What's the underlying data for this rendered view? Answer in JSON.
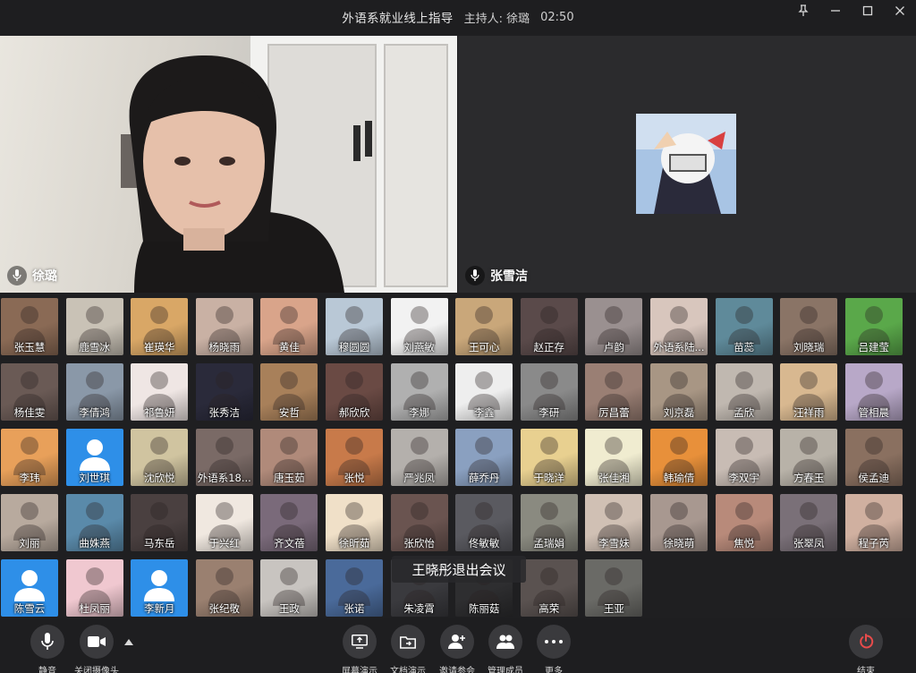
{
  "window": {
    "title": "外语系就业线上指导",
    "host": "主持人: 徐璐",
    "time": "02:50"
  },
  "main_videos": {
    "left_name": "徐璐",
    "right_name": "张雪洁"
  },
  "participants": [
    {
      "name": "张玉慧",
      "color": "#8a6a55"
    },
    {
      "name": "鹿雪冰",
      "color": "#c9c2b6"
    },
    {
      "name": "崔瑛华",
      "color": "#d9a766"
    },
    {
      "name": "杨晓雨",
      "color": "#c9b1a4"
    },
    {
      "name": "黄佳",
      "color": "#d9a48a"
    },
    {
      "name": "穆圆圆",
      "color": "#b9c8d6"
    },
    {
      "name": "刘燕敏",
      "color": "#f2f2f2"
    },
    {
      "name": "王可心",
      "color": "#c9a77a"
    },
    {
      "name": "赵正存",
      "color": "#5a4a4a"
    },
    {
      "name": "卢韵",
      "color": "#9a9090"
    },
    {
      "name": "外语系陆...",
      "color": "#d8c6bd"
    },
    {
      "name": "苗蕊",
      "color": "#5f8a9a"
    },
    {
      "name": "刘晓瑞",
      "color": "#8a7466"
    },
    {
      "name": "吕建莹",
      "color": "#5aa84a"
    },
    {
      "name": "杨佳雯",
      "color": "#6a5a55"
    },
    {
      "name": "李倩鸿",
      "color": "#8a98a8"
    },
    {
      "name": "祁鲁妍",
      "color": "#efe6e4"
    },
    {
      "name": "张秀洁",
      "color": "#2a2a3a"
    },
    {
      "name": "安哲",
      "color": "#a8805a"
    },
    {
      "name": "郝欣欣",
      "color": "#6a4a44"
    },
    {
      "name": "李娜",
      "color": "#b0b0b0"
    },
    {
      "name": "李鑫",
      "color": "#eeeeee"
    },
    {
      "name": "李研",
      "color": "#8a8a8a"
    },
    {
      "name": "厉昌蕾",
      "color": "#9a7f74"
    },
    {
      "name": "刘京磊",
      "color": "#a89684"
    },
    {
      "name": "孟欣",
      "color": "#c0b8b0"
    },
    {
      "name": "汪祥雨",
      "color": "#d8b890"
    },
    {
      "name": "管相晨",
      "color": "#b8a8c8"
    },
    {
      "name": "李玮",
      "color": "#e8a05a"
    },
    {
      "name": "刘世琪",
      "color": "#2e8fe8",
      "avatar": true
    },
    {
      "name": "沈欣悦",
      "color": "#d0c4a0"
    },
    {
      "name": "外语系18...",
      "color": "#7a6a66"
    },
    {
      "name": "唐玉茹",
      "color": "#b08a7a"
    },
    {
      "name": "张悦",
      "color": "#c87a4a"
    },
    {
      "name": "严兆凤",
      "color": "#b4b0ac"
    },
    {
      "name": "薛乔丹",
      "color": "#8aa0c0"
    },
    {
      "name": "于晓洋",
      "color": "#e8d090"
    },
    {
      "name": "张佳湘",
      "color": "#f0ecd0"
    },
    {
      "name": "韩瑜倩",
      "color": "#e8903a"
    },
    {
      "name": "李双宇",
      "color": "#c8bcb4"
    },
    {
      "name": "方春玉",
      "color": "#b8b2a8"
    },
    {
      "name": "侯孟迪",
      "color": "#8a7060"
    },
    {
      "name": "刘丽",
      "color": "#b8aa9e"
    },
    {
      "name": "曲姝燕",
      "color": "#5a8aaa"
    },
    {
      "name": "马东岳",
      "color": "#4a4040"
    },
    {
      "name": "于兴红",
      "color": "#f0e8e0"
    },
    {
      "name": "齐文蓓",
      "color": "#7a6a7a"
    },
    {
      "name": "徐昕茹",
      "color": "#f0e0c8"
    },
    {
      "name": "张欣怡",
      "color": "#6a5450"
    },
    {
      "name": "佟敏敏",
      "color": "#5a5a60"
    },
    {
      "name": "孟瑞娟",
      "color": "#8a8a80"
    },
    {
      "name": "李雪妹",
      "color": "#d0c0b4"
    },
    {
      "name": "徐晓萌",
      "color": "#a89890"
    },
    {
      "name": "焦悦",
      "color": "#b88a7a"
    },
    {
      "name": "张翠凤",
      "color": "#7a7078"
    },
    {
      "name": "程子芮",
      "color": "#d0b0a0"
    },
    {
      "name": "陈雪云",
      "color": "#2e8fe8",
      "avatar": true
    },
    {
      "name": "杜凤丽",
      "color": "#f0c8d0"
    },
    {
      "name": "李新月",
      "color": "#2e8fe8",
      "avatar": true
    },
    {
      "name": "张纪敬",
      "color": "#9a8070"
    },
    {
      "name": "王政",
      "color": "#c8c4c0"
    },
    {
      "name": "张诺",
      "color": "#4a6a9a"
    },
    {
      "name": "朱凌霄",
      "color": "#3a3a3e"
    },
    {
      "name": "陈丽菇",
      "color": "#2e2e30"
    },
    {
      "name": "高荣",
      "color": "#5a5250"
    },
    {
      "name": "王亚",
      "color": "#6a6a66"
    }
  ],
  "toast": "王晓彤退出会议",
  "toolbar": {
    "mute": "静音",
    "camera_off": "关闭摄像头",
    "screen_share": "屏幕演示",
    "doc_share": "文档演示",
    "invite": "邀请参会",
    "manage": "管理成员",
    "more": "更多",
    "end": "结束"
  },
  "colors": {
    "background": "#1f1f21",
    "tile_avatar_blue": "#2e8fe8",
    "end_red": "#e84b4b"
  }
}
